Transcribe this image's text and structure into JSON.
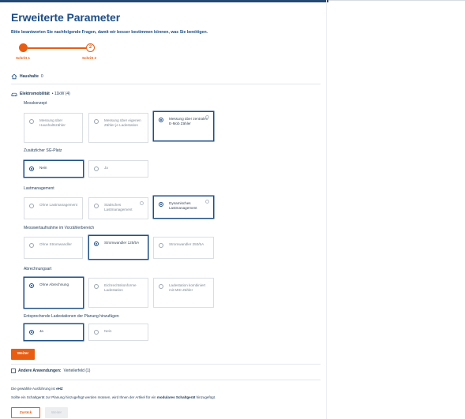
{
  "header": {
    "title": "Erweiterte Parameter",
    "subtitle": "Bitte beantworten Sie nachfolgende Fragen, damit wir besser bestimmen können, was Sie benötigen."
  },
  "stepper": {
    "step1_label": "Schritt 1",
    "step2_number": "2",
    "step2_label": "Schritt 2"
  },
  "households": {
    "label": "Haushalte",
    "count": "0"
  },
  "emobility": {
    "label": "Elektromobilität",
    "detail": "• 11kW (4)"
  },
  "groups": [
    {
      "label": "Messkonzept",
      "options": [
        {
          "text": "Messung über Haushaltszähler"
        },
        {
          "text": "Messung über eigenen Zähler je Ladestation"
        },
        {
          "text": "Messung über zentralen E-Mob Zähler"
        }
      ]
    },
    {
      "label": "Zusätzlicher SG-Platz",
      "options": [
        {
          "text": "Nein"
        },
        {
          "text": "Ja"
        }
      ]
    },
    {
      "label": "Lastmanagement",
      "options": [
        {
          "text": "Ohne Lastmanagement"
        },
        {
          "text": "Statisches Lastmanagement"
        },
        {
          "text": "Dynamisches Lastmanagement"
        }
      ]
    },
    {
      "label": "Messwertaufnahme im Vorzählerbereich",
      "options": [
        {
          "text": "Ohne Stromwandler"
        },
        {
          "text": "Stromwandler 125/5A"
        },
        {
          "text": "Stromwandler 250/5A"
        }
      ]
    },
    {
      "label": "Abrechnungsart",
      "options": [
        {
          "text": "Ohne Abrechnung"
        },
        {
          "text": "Eichrechtskonforme Ladestation"
        },
        {
          "text": "Ladestation kombiniert mit MID Zähler"
        }
      ]
    },
    {
      "label": "Entsprechende Ladestationen der Planung hinzufügen",
      "options": [
        {
          "text": "Ja"
        },
        {
          "text": "Nein"
        }
      ]
    }
  ],
  "buttons": {
    "weiter": "Weiter",
    "zurueck": "Zurück",
    "weiter_disabled": "Weiter"
  },
  "other_usage": {
    "label": "Andere Anwendungen:",
    "detail": "Verteilerfeld (1)"
  },
  "notes": {
    "line1_prefix": "Die gewählte Ausführung ist",
    "line1_bold": "eHZ",
    "line2_prefix": "Sollte ein Schaltgerät zur Planung hinzugefügt werden müssen, wird Ihnen der Artikel für ein",
    "line2_bold": "modulares Schaltgerät",
    "line2_suffix": "hinzugefügt."
  },
  "colors": {
    "primary": "#1e4f86",
    "accent": "#e85d12"
  }
}
